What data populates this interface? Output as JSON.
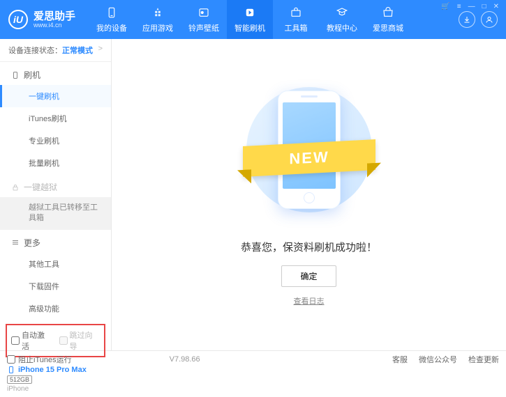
{
  "header": {
    "app_name": "爱思助手",
    "app_url": "www.i4.cn",
    "nav": [
      {
        "label": "我的设备"
      },
      {
        "label": "应用游戏"
      },
      {
        "label": "铃声壁纸"
      },
      {
        "label": "智能刷机"
      },
      {
        "label": "工具箱"
      },
      {
        "label": "教程中心"
      },
      {
        "label": "爱思商城"
      }
    ]
  },
  "status": {
    "prefix": "设备连接状态：",
    "mode": "正常模式",
    "gt": ">"
  },
  "sidebar": {
    "sec_flash": "刷机",
    "items_flash": [
      "一键刷机",
      "iTunes刷机",
      "专业刷机",
      "批量刷机"
    ],
    "sec_jailbreak": "一键越狱",
    "jailbreak_note": "越狱工具已转移至工具箱",
    "sec_more": "更多",
    "items_more": [
      "其他工具",
      "下载固件",
      "高级功能"
    ],
    "cb_auto": "自动激活",
    "cb_skip": "跳过向导"
  },
  "device": {
    "name": "iPhone 15 Pro Max",
    "storage": "512GB",
    "type": "iPhone"
  },
  "main": {
    "ribbon": "NEW",
    "message": "恭喜您，保资料刷机成功啦！",
    "ok": "确定",
    "view_log": "查看日志"
  },
  "footer": {
    "block_itunes": "阻止iTunes运行",
    "version": "V7.98.66",
    "links": [
      "客服",
      "微信公众号",
      "检查更新"
    ]
  }
}
